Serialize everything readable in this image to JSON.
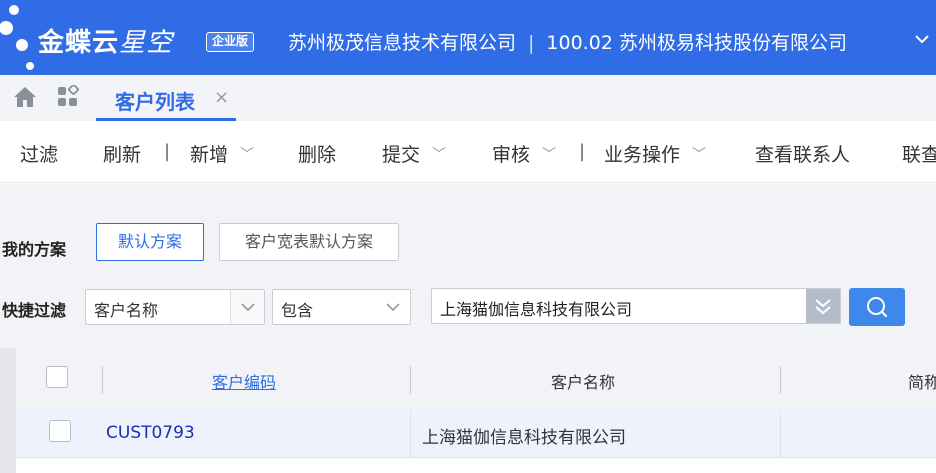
{
  "header": {
    "brand_main": "金蝶云",
    "brand_sub": "星空",
    "edition_badge": "企业版",
    "org_name": "苏州极茂信息技术有限公司",
    "org_separator": "|",
    "account_name": "100.02 苏州极易科技股份有限公司",
    "brand_color": "#2f6ce5"
  },
  "tabs": {
    "home_icon": "home-icon",
    "apps_icon": "apps-grid-icon",
    "active_tab": {
      "label": "客户列表",
      "close": "×"
    }
  },
  "toolbar": {
    "filter": "过滤",
    "refresh": "刷新",
    "sep": "|",
    "add": "新增",
    "delete": "删除",
    "submit": "提交",
    "audit": "审核",
    "business_ops": "业务操作",
    "view_contacts": "查看联系人",
    "more_cut": "联查"
  },
  "filter_panel": {
    "my_schemes_label": "我的方案",
    "scheme_default": "默认方案",
    "scheme_wide": "客户宽表默认方案",
    "quick_filter_label": "快捷过滤",
    "field_select": "客户名称",
    "operator_select": "包含",
    "search_value": "上海猫伽信息科技有限公司"
  },
  "grid": {
    "columns": [
      "客户编码",
      "客户名称",
      "简称"
    ],
    "rows": [
      {
        "code": "CUST0793",
        "name": "上海猫伽信息科技有限公司",
        "short": ""
      }
    ]
  }
}
